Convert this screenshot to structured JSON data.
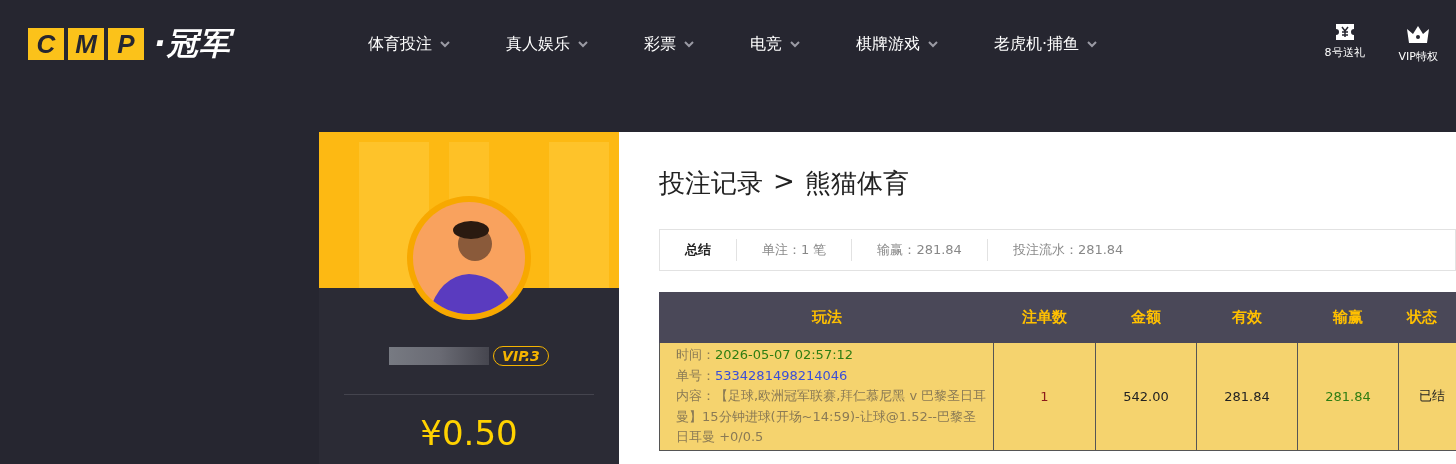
{
  "header": {
    "logo": {
      "letters": [
        "C",
        "M",
        "P"
      ],
      "name": "·冠军"
    },
    "nav": [
      {
        "label": "体育投注"
      },
      {
        "label": "真人娱乐"
      },
      {
        "label": "彩票"
      },
      {
        "label": "电竞"
      },
      {
        "label": "棋牌游戏"
      },
      {
        "label": "老虎机·捕鱼"
      }
    ],
    "quick_links": [
      {
        "kind": "ticket",
        "label": "8号送礼"
      },
      {
        "kind": "crown",
        "label": "VIP特权"
      }
    ]
  },
  "profile": {
    "vip": "VIP.3",
    "balance": "¥0.50"
  },
  "page": {
    "breadcrumb": [
      "投注记录",
      ">",
      "熊猫体育"
    ],
    "summary": [
      {
        "kind": "title",
        "text": "总结"
      },
      {
        "kind": "stat",
        "text": "单注：1 笔"
      },
      {
        "kind": "stat",
        "text": "输赢：281.84"
      },
      {
        "kind": "stat",
        "text": "投注流水：281.84"
      }
    ],
    "table": {
      "columns": [
        "玩法",
        "注单数",
        "金额",
        "有效",
        "输赢",
        "状态"
      ],
      "rows": [
        {
          "time_label": "时间：",
          "time": "2026-05-07 02:57:12",
          "id_label": "单号：",
          "id": "5334281498214046",
          "content_label": "内容：",
          "content": "【足球,欧洲冠军联赛,拜仁慕尼黑 v 巴黎圣日耳曼】15分钟进球(开场~14:59)-让球@1.52--巴黎圣日耳曼 +0/0.5",
          "count": "1",
          "amount": "542.00",
          "valid": "281.84",
          "win": "281.84",
          "status": "已结"
        }
      ]
    }
  }
}
